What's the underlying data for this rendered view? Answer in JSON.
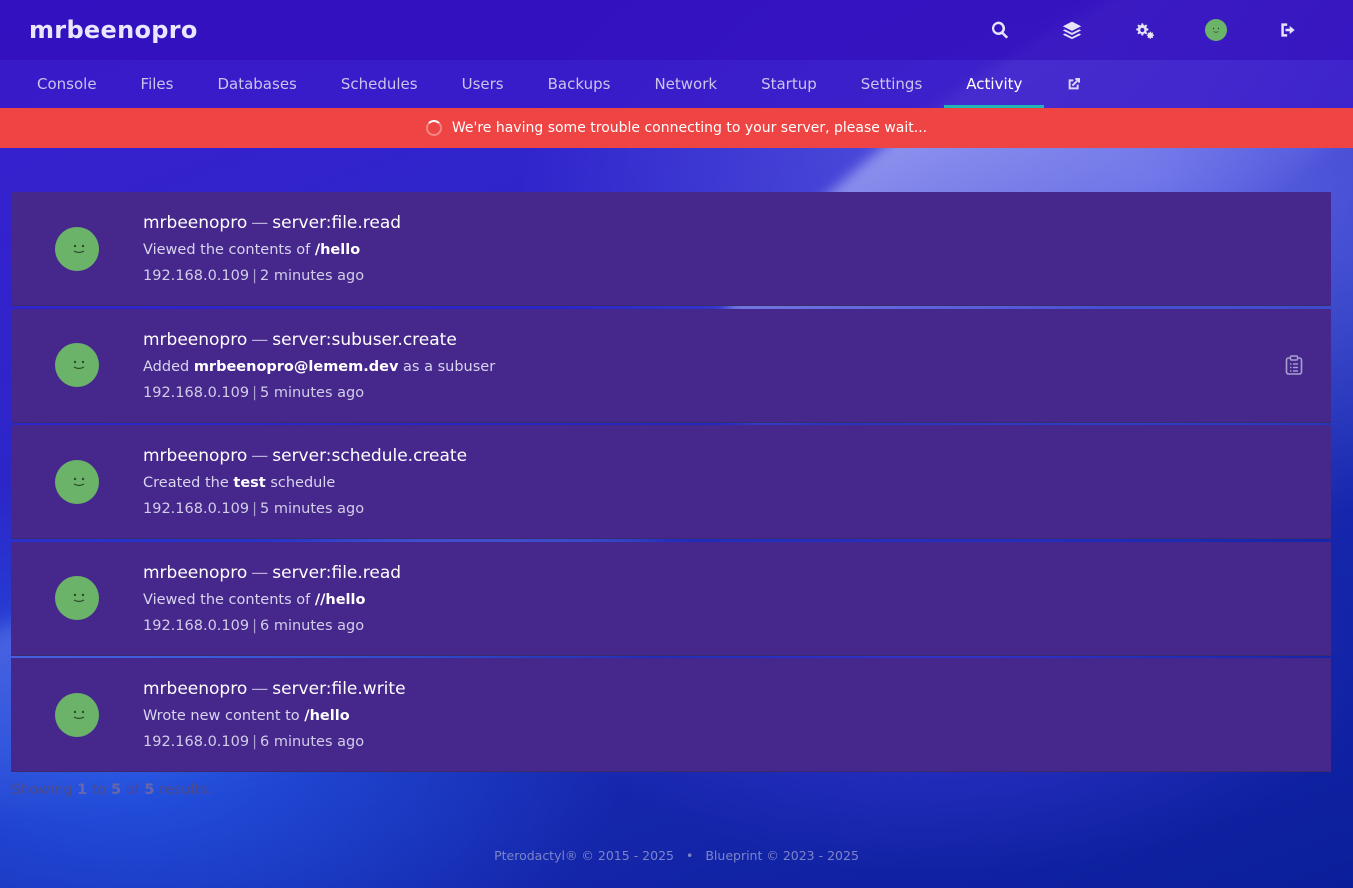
{
  "brand": "mrbeenopro",
  "topbar": {
    "icons": [
      "search-icon",
      "layers-icon",
      "cogs-icon",
      "avatar",
      "sign-out-icon"
    ]
  },
  "nav": {
    "tabs": [
      {
        "label": "Console"
      },
      {
        "label": "Files"
      },
      {
        "label": "Databases"
      },
      {
        "label": "Schedules"
      },
      {
        "label": "Users"
      },
      {
        "label": "Backups"
      },
      {
        "label": "Network"
      },
      {
        "label": "Startup"
      },
      {
        "label": "Settings"
      },
      {
        "label": "Activity",
        "active": true
      }
    ],
    "external_icon": "external-link-icon"
  },
  "alert": {
    "message": "We're having some trouble connecting to your server, please wait..."
  },
  "activity": [
    {
      "user": "mrbeenopro",
      "separator": "—",
      "event": "server:file.read",
      "desc_before": "Viewed the contents of ",
      "desc_bold": "/hello",
      "desc_after": "",
      "ip": "192.168.0.109",
      "time": "2 minutes ago"
    },
    {
      "user": "mrbeenopro",
      "separator": "—",
      "event": "server:subuser.create",
      "desc_before": "Added ",
      "desc_bold": "mrbeenopro@lemem.dev",
      "desc_after": " as a subuser",
      "ip": "192.168.0.109",
      "time": "5 minutes ago",
      "has_clipboard": true
    },
    {
      "user": "mrbeenopro",
      "separator": "—",
      "event": "server:schedule.create",
      "desc_before": "Created the ",
      "desc_bold": "test",
      "desc_after": " schedule",
      "ip": "192.168.0.109",
      "time": "5 minutes ago"
    },
    {
      "user": "mrbeenopro",
      "separator": "—",
      "event": "server:file.read",
      "desc_before": "Viewed the contents of ",
      "desc_bold": "//hello",
      "desc_after": "",
      "ip": "192.168.0.109",
      "time": "6 minutes ago"
    },
    {
      "user": "mrbeenopro",
      "separator": "—",
      "event": "server:file.write",
      "desc_before": "Wrote new content to ",
      "desc_bold": "/hello",
      "desc_after": "",
      "ip": "192.168.0.109",
      "time": "6 minutes ago"
    }
  ],
  "meta_separator": "|",
  "pagination": {
    "showing": "Showing",
    "from": "1",
    "to_word": "to",
    "to": "5",
    "of_word": "of",
    "total": "5",
    "results": "results."
  },
  "footer": {
    "left": "Pterodactyl® © 2015 - 2025",
    "dot": "•",
    "right": "Blueprint © 2023 - 2025"
  },
  "colors": {
    "topbar": "#3410be",
    "alert": "#ef4444",
    "row_bg": "#46288c",
    "active_tab_underline": "#22b5b8",
    "avatar": "#6cb36a"
  }
}
